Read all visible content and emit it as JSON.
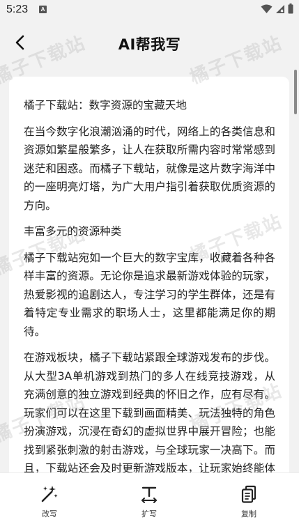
{
  "status_bar": {
    "time": "5:23",
    "app_icon_letter": "A"
  },
  "header": {
    "title": "AI帮我写"
  },
  "watermark": "橘子下载站",
  "content": {
    "paragraphs": [
      "橘子下载站：数字资源的宝藏天地",
      "在当今数字化浪潮汹涌的时代，网络上的各类信息和资源如繁星般繁多，让人在获取所需内容时常常感到迷茫和困惑。而橘子下载站，就像是这片数字海洋中的一座明亮灯塔，为广大用户指引着获取优质资源的方向。",
      "丰富多元的资源种类",
      "橘子下载站宛如一个巨大的数字宝库，收藏着各种各样丰富的资源。无论你是追求最新游戏体验的玩家，热爱影视的追剧达人，专注学习的学生群体，还是有着特定专业需求的职场人士，这里都能满足你的期待。",
      "在游戏板块，橘子下载站紧跟全球游戏发布的步伐。从大型3A单机游戏到热门的多人在线竞技游戏，从充满创意的独立游戏到经典的怀旧之作，应有尽有。玩家们可以在这里下载到画面精美、玩法独特的角色扮演游戏，沉浸在奇幻的虚拟世界中展开冒险；也能找到紧张刺激的射击游戏，与全球玩家一决高下。而且，下载站还会及时更新游戏版本，让玩家始终能体验到游戏的最"
    ]
  },
  "actions": [
    {
      "label": "改写",
      "icon": "magic-wand-icon"
    },
    {
      "label": "扩写",
      "icon": "expand-text-icon"
    },
    {
      "label": "复制",
      "icon": "copy-icon"
    }
  ]
}
